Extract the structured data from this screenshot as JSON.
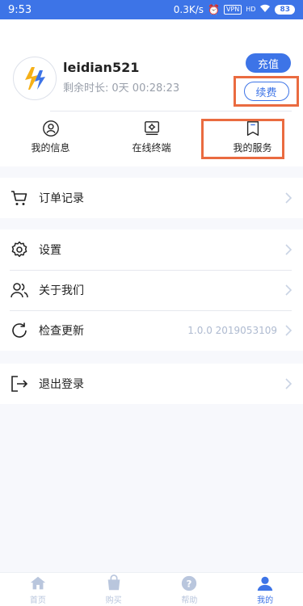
{
  "status_bar": {
    "time": "9:53",
    "net_speed": "0.3K/s",
    "vpn": "VPN",
    "signal_type": "HD",
    "battery": "83"
  },
  "profile": {
    "username": "leidian521",
    "remaining_label": "剩余时长:",
    "remaining_value": "0天 00:28:23",
    "recharge_label": "充值",
    "renew_label": "续费"
  },
  "quick_actions": [
    {
      "label": "我的信息",
      "icon": "user-circle-icon"
    },
    {
      "label": "在线终端",
      "icon": "terminal-gear-icon"
    },
    {
      "label": "我的服务",
      "icon": "bookmark-icon"
    }
  ],
  "menu": {
    "orders": {
      "label": "订单记录",
      "icon": "cart-icon"
    },
    "settings": {
      "label": "设置",
      "icon": "gear-icon"
    },
    "about": {
      "label": "关于我们",
      "icon": "users-icon"
    },
    "update": {
      "label": "检查更新",
      "icon": "refresh-icon",
      "value": "1.0.0 2019053109"
    },
    "logout": {
      "label": "退出登录",
      "icon": "logout-icon"
    }
  },
  "bottom_nav": [
    {
      "label": "首页",
      "icon": "home-icon",
      "active": false
    },
    {
      "label": "购买",
      "icon": "shopping-bag-icon",
      "active": false
    },
    {
      "label": "帮助",
      "icon": "help-icon",
      "active": false
    },
    {
      "label": "我的",
      "icon": "profile-icon",
      "active": true
    }
  ],
  "colors": {
    "accent": "#3d74e7",
    "highlight": "#ea6b40",
    "inactive_nav": "#b9c6dd"
  }
}
